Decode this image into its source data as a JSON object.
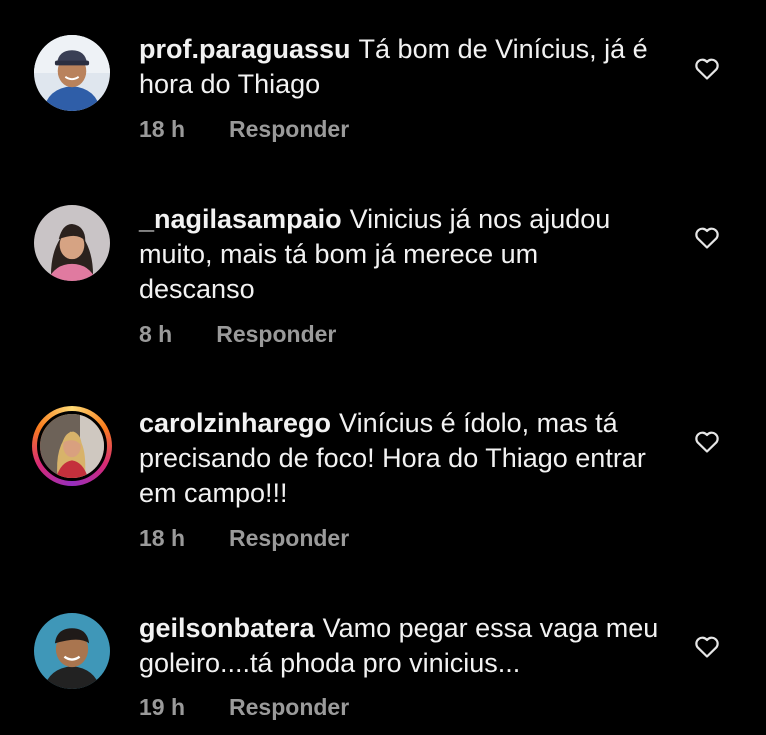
{
  "comments": [
    {
      "username": "prof.paraguassu",
      "text": "Tá bom de Vinícius, já é hora do Thiago",
      "time": "18 h",
      "reply_label": "Responder",
      "avatar_icon": "avatar-man-cap",
      "has_story_ring": false
    },
    {
      "username": "_nagilasampaio",
      "text": "Vinicius já nos ajudou muito, mais tá bom já merece um descanso",
      "time": "8 h",
      "reply_label": "Responder",
      "avatar_icon": "avatar-woman",
      "has_story_ring": false
    },
    {
      "username": "carolzinharego",
      "text": "Vinícius é ídolo, mas tá precisando de foco! Hora do Thiago entrar em campo!!!",
      "time": "18 h",
      "reply_label": "Responder",
      "avatar_icon": "avatar-woman-blonde",
      "has_story_ring": true
    },
    {
      "username": "geilsonbatera",
      "text": "Vamo pegar essa vaga meu goleiro....tá phoda pro vinicius...",
      "time": "19 h",
      "reply_label": "Responder",
      "avatar_icon": "avatar-man",
      "has_story_ring": false
    }
  ],
  "colors": {
    "background": "#000000",
    "text": "#f2f2f2",
    "meta": "#9a9a9a"
  }
}
